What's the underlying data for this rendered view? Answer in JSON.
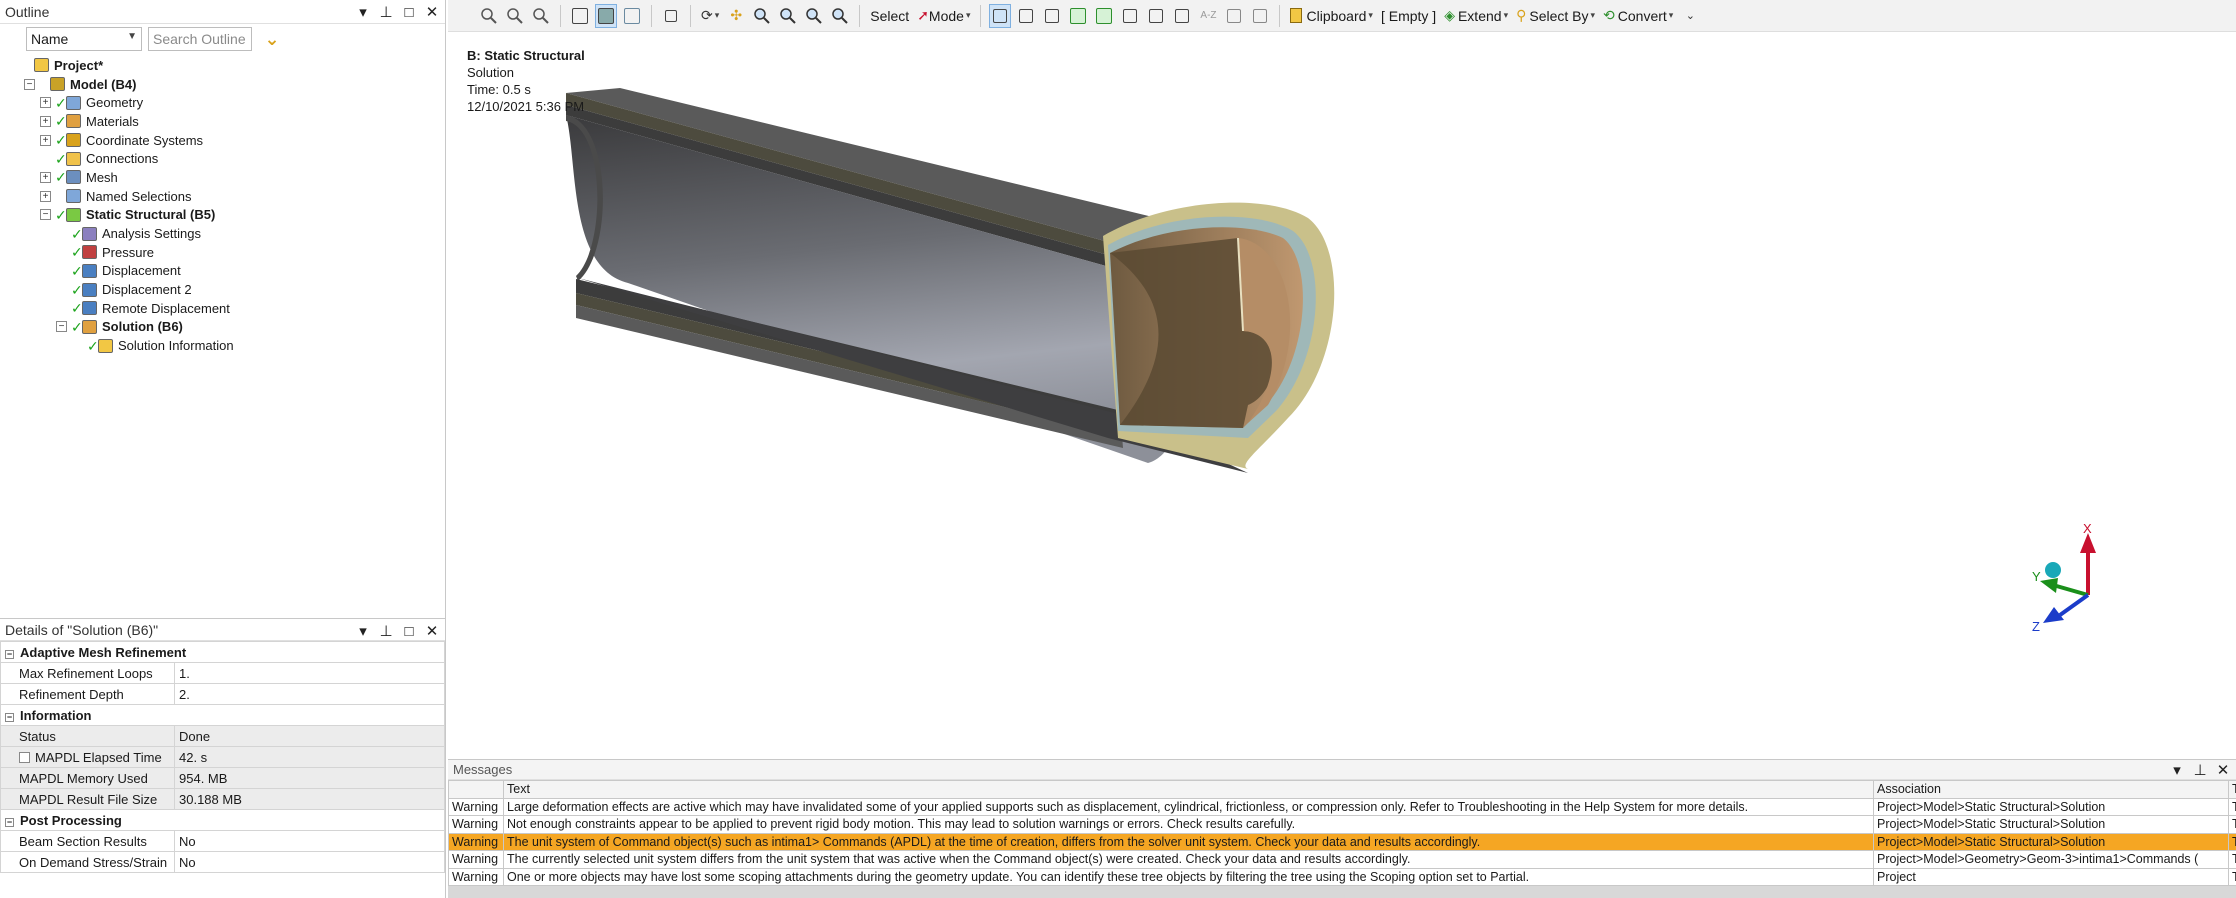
{
  "outline": {
    "title": "Outline",
    "filter_select": "Name",
    "search_placeholder": "Search Outline",
    "tree": [
      {
        "label": "Project*",
        "bold": true,
        "indent": 0,
        "expander": "",
        "check": false,
        "icon": "project-icon"
      },
      {
        "label": "Model (B4)",
        "bold": true,
        "indent": 1,
        "expander": "-",
        "check": false,
        "icon": "model-icon"
      },
      {
        "label": "Geometry",
        "bold": false,
        "indent": 2,
        "expander": "+",
        "check": true,
        "icon": "geometry-icon"
      },
      {
        "label": "Materials",
        "bold": false,
        "indent": 2,
        "expander": "+",
        "check": true,
        "icon": "materials-icon"
      },
      {
        "label": "Coordinate Systems",
        "bold": false,
        "indent": 2,
        "expander": "+",
        "check": true,
        "icon": "coordinate-systems-icon"
      },
      {
        "label": "Connections",
        "bold": false,
        "indent": 2,
        "expander": "",
        "check": true,
        "icon": "connections-icon"
      },
      {
        "label": "Mesh",
        "bold": false,
        "indent": 2,
        "expander": "+",
        "check": true,
        "icon": "mesh-icon"
      },
      {
        "label": "Named Selections",
        "bold": false,
        "indent": 2,
        "expander": "+",
        "check": false,
        "icon": "named-selections-icon"
      },
      {
        "label": "Static Structural (B5)",
        "bold": true,
        "indent": 2,
        "expander": "-",
        "check": true,
        "icon": "static-structural-icon"
      },
      {
        "label": "Analysis Settings",
        "bold": false,
        "indent": 3,
        "expander": "",
        "check": true,
        "icon": "analysis-settings-icon"
      },
      {
        "label": "Pressure",
        "bold": false,
        "indent": 3,
        "expander": "",
        "check": true,
        "icon": "pressure-icon"
      },
      {
        "label": "Displacement",
        "bold": false,
        "indent": 3,
        "expander": "",
        "check": true,
        "icon": "displacement-icon"
      },
      {
        "label": "Displacement 2",
        "bold": false,
        "indent": 3,
        "expander": "",
        "check": true,
        "icon": "displacement-icon"
      },
      {
        "label": "Remote Displacement",
        "bold": false,
        "indent": 3,
        "expander": "",
        "check": true,
        "icon": "remote-displacement-icon"
      },
      {
        "label": "Solution (B6)",
        "bold": true,
        "indent": 3,
        "expander": "-",
        "check": true,
        "icon": "solution-icon"
      },
      {
        "label": "Solution Information",
        "bold": false,
        "indent": 4,
        "expander": "",
        "check": true,
        "icon": "solution-information-icon"
      }
    ]
  },
  "details": {
    "title": "Details of \"Solution (B6)\"",
    "sections": [
      {
        "name": "Adaptive Mesh Refinement",
        "rows": [
          {
            "name": "Max Refinement Loops",
            "value": "1.",
            "gray": false,
            "checkbox": false
          },
          {
            "name": "Refinement Depth",
            "value": "2.",
            "gray": false,
            "checkbox": false
          }
        ]
      },
      {
        "name": "Information",
        "rows": [
          {
            "name": "Status",
            "value": "Done",
            "gray": true,
            "checkbox": false
          },
          {
            "name": "MAPDL Elapsed Time",
            "value": "42. s",
            "gray": true,
            "checkbox": true
          },
          {
            "name": "MAPDL Memory Used",
            "value": "954. MB",
            "gray": true,
            "checkbox": false
          },
          {
            "name": "MAPDL Result File Size",
            "value": "30.188 MB",
            "gray": true,
            "checkbox": false
          }
        ]
      },
      {
        "name": "Post Processing",
        "rows": [
          {
            "name": "Beam Section Results",
            "value": "No",
            "gray": false,
            "checkbox": false
          },
          {
            "name": "On Demand Stress/Strain",
            "value": "No",
            "gray": false,
            "checkbox": false
          }
        ]
      }
    ]
  },
  "toolbar": {
    "select_label": "Select",
    "mode_label": "Mode",
    "clipboard_label": "Clipboard",
    "empty_label": "[ Empty ]",
    "extend_label": "Extend",
    "select_by_label": "Select By",
    "convert_label": "Convert"
  },
  "viewport": {
    "title": "B: Static Structural",
    "subtitle": "Solution",
    "time": "Time: 0.5 s",
    "date": "12/10/2021 5:36 PM",
    "axis_x": "X",
    "axis_y": "Y",
    "axis_z": "Z"
  },
  "messages": {
    "title": "Messages",
    "headers": [
      "",
      "Text",
      "Association",
      "T"
    ],
    "rows": [
      {
        "type": "Warning",
        "text": "Large deformation effects are active which may have invalidated some of your applied supports such as displacement, cylindrical, frictionless, or compression only.  Refer to Troubleshooting in the Help System for more details.",
        "association": "Project>Model>Static Structural>Solution",
        "t": "T",
        "selected": false
      },
      {
        "type": "Warning",
        "text": "Not enough constraints appear to be applied to prevent rigid body motion.  This may lead to solution warnings or errors.  Check results carefully.",
        "association": "Project>Model>Static Structural>Solution",
        "t": "T",
        "selected": false
      },
      {
        "type": "Warning",
        "text": "The unit system of Command object(s) such as  intima1> Commands (APDL) at the time of creation, differs from the solver unit system.  Check your data and results accordingly.",
        "association": "Project>Model>Static Structural>Solution",
        "t": "T",
        "selected": true
      },
      {
        "type": "Warning",
        "text": "The currently selected unit system differs from the unit system that was active when the Command object(s) were created.  Check your data and results accordingly.",
        "association": "Project>Model>Geometry>Geom-3>intima1>Commands (",
        "t": "T",
        "selected": false
      },
      {
        "type": "Warning",
        "text": "One or more objects may have lost some scoping attachments during the geometry update. You can identify these tree objects by filtering the tree using the Scoping option set to Partial.",
        "association": "Project",
        "t": "T",
        "selected": false
      }
    ]
  },
  "colors": {
    "check": "#1aa31a",
    "selected_row": "#f5a623",
    "arrow_x": "#c8102e",
    "arrow_y": "#1a8f1a",
    "arrow_z": "#1b3cc9"
  }
}
